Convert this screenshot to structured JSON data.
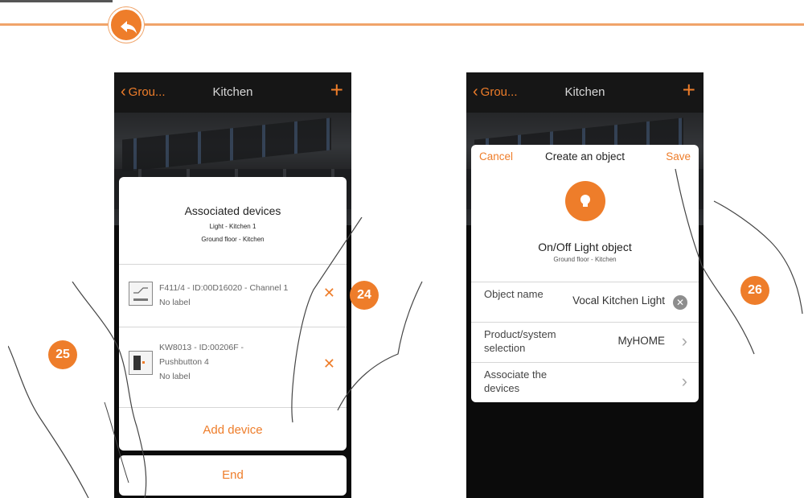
{
  "colors": {
    "accent": "#ee7d2a",
    "header_rule": "#f0a46a"
  },
  "header": {
    "back_icon": "back-arrow-icon"
  },
  "steps": {
    "s24": "24",
    "s25": "25",
    "s26": "26"
  },
  "phone_a": {
    "nav": {
      "back": "Grou...",
      "title": "Kitchen",
      "plus": "+"
    },
    "modal": {
      "title": "Associated devices",
      "subtitle1": "Light - Kitchen 1",
      "subtitle2": "Ground floor - Kitchen",
      "devices": [
        {
          "line1": "F411/4 - ID:00D16020 - Channel 1",
          "line2": "No label",
          "icon": "dimmer-device-icon"
        },
        {
          "line1": "KW8013 - ID:00206F -",
          "line2": "Pushbutton 4",
          "line3": "No label",
          "icon": "pushbutton-device-icon"
        }
      ],
      "add_device": "Add device"
    },
    "end": "End"
  },
  "phone_b": {
    "nav": {
      "back": "Grou...",
      "title": "Kitchen",
      "plus": "+"
    },
    "modal": {
      "cancel": "Cancel",
      "title": "Create an object",
      "save": "Save",
      "object_title": "On/Off Light object",
      "object_sub": "Ground floor - Kitchen",
      "fields": [
        {
          "label": "Object name",
          "value": "Vocal Kitchen Light",
          "action": "clear"
        },
        {
          "label": "Product/system selection",
          "value": "MyHOME",
          "action": "chevron"
        },
        {
          "label": "Associate the devices",
          "value": "",
          "action": "chevron"
        }
      ]
    }
  }
}
